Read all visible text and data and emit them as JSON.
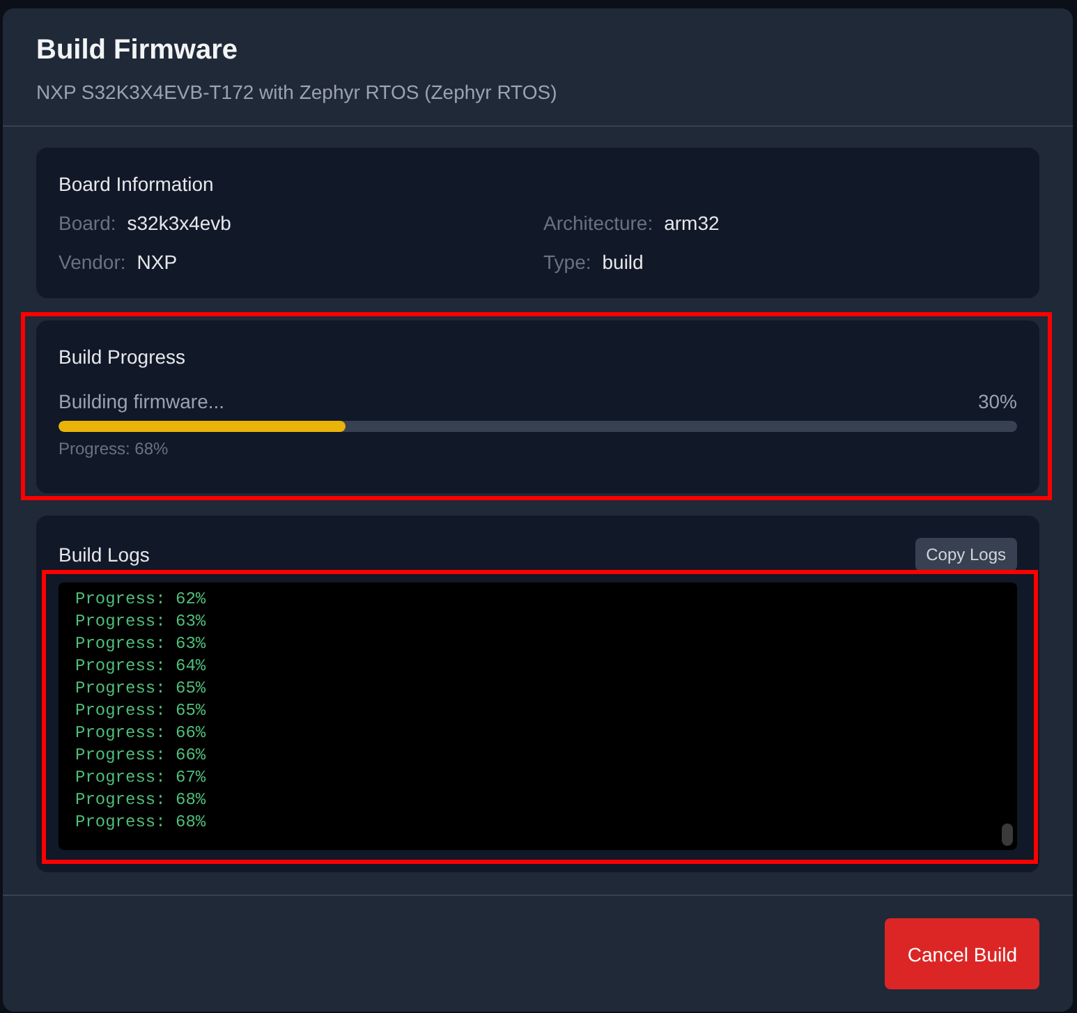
{
  "dialog": {
    "title": "Build Firmware",
    "subtitle": "NXP S32K3X4EVB-T172 with Zephyr RTOS (Zephyr RTOS)"
  },
  "board_information": {
    "title": "Board Information",
    "fields": [
      {
        "label": "Board:",
        "value": "s32k3x4evb"
      },
      {
        "label": "Architecture:",
        "value": "arm32"
      },
      {
        "label": "Vendor:",
        "value": "NXP"
      },
      {
        "label": "Type:",
        "value": "build"
      }
    ]
  },
  "build_progress": {
    "title": "Build Progress",
    "highlighted": true,
    "status": "Building firmware...",
    "percent": "30%",
    "level": 0.3,
    "detail": "Progress: 68%"
  },
  "build_logs": {
    "title": "Build Logs",
    "copy_button": "Copy Logs",
    "highlighted": true,
    "lines": [
      "Progress: 62%",
      "Progress: 63%",
      "Progress: 63%",
      "Progress: 64%",
      "Progress: 65%",
      "Progress: 65%",
      "Progress: 66%",
      "Progress: 66%",
      "Progress: 67%",
      "Progress: 68%",
      "Progress: 68%"
    ]
  },
  "footer": {
    "buttons": [
      {
        "label": "Cancel Build",
        "kind": "danger"
      }
    ]
  }
}
